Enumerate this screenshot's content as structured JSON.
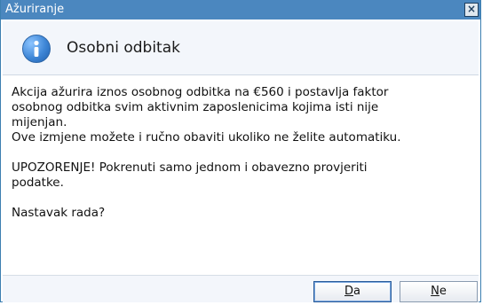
{
  "window": {
    "title": "Ažuriranje",
    "close_label": "×"
  },
  "header": {
    "icon": "info-icon",
    "title": "Osobni odbitak"
  },
  "message": {
    "line1": "Akcija ažurira iznos osobnog odbitka na €560 i postavlja faktor",
    "line2": "osobnog odbitka svim aktivnim zaposlenicima kojima isti nije",
    "line3": "mijenjan.",
    "line4": "Ove izmjene možete i ručno obaviti ukoliko ne želite automatiku.",
    "warning_line1": "UPOZORENJE! Pokrenuti samo jednom i obavezno provjeriti",
    "warning_line2": "podatke.",
    "question": "Nastavak rada?"
  },
  "buttons": {
    "yes": {
      "mnemonic": "D",
      "rest": "a"
    },
    "no": {
      "mnemonic": "N",
      "rest": "e"
    }
  }
}
